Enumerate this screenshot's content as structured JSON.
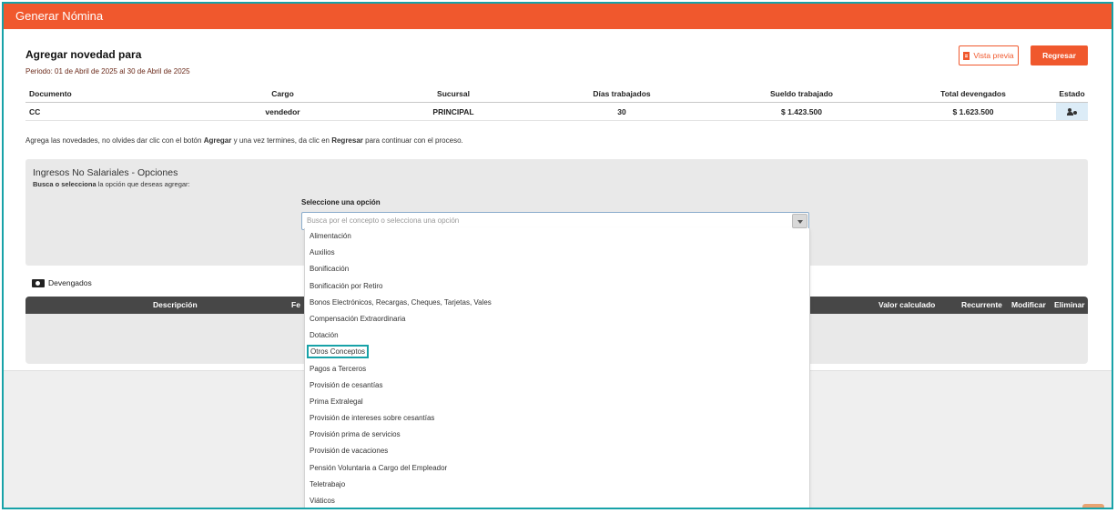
{
  "header": {
    "title": "Generar Nómina"
  },
  "page": {
    "title": "Agregar novedad para",
    "period": "Periodo: 01 de Abril de 2025 al 30 de Abril de 2025",
    "preview_label": "Vista previa",
    "back_label": "Regresar"
  },
  "summary": {
    "columns": [
      "Documento",
      "Cargo",
      "Sucursal",
      "Días trabajados",
      "Sueldo trabajado",
      "Total devengados",
      "Estado"
    ],
    "row": {
      "documento": "CC",
      "cargo": "vendedor",
      "sucursal": "PRINCIPAL",
      "dias": "30",
      "sueldo": "$ 1.423.500",
      "total": "$ 1.623.500"
    }
  },
  "note": {
    "part1": "Agrega las novedades, no olvides dar clic con el botón ",
    "bold1": "Agregar",
    "part2": " y una vez termines, da clic en ",
    "bold2": "Regresar",
    "part3": " para continuar con el proceso."
  },
  "panel": {
    "title": "Ingresos No Salariales - Opciones",
    "sub_bold": "Busca o selecciona",
    "sub_rest": " la opción que deseas agregar:",
    "select_label": "Seleccione una opción",
    "select_placeholder": "Busca por el concepto o selecciona una opción"
  },
  "options": [
    "Alimentación",
    "Auxilios",
    "Bonificación",
    "Bonificación por Retiro",
    "Bonos Electrónicos, Recargas, Cheques, Tarjetas, Vales",
    "Compensación Extraordinaria",
    "Dotación",
    "Otros Conceptos",
    "Pagos a Terceros",
    "Provisión de cesantías",
    "Prima Extralegal",
    "Provisión de intereses sobre cesantías",
    "Provisión prima de servicios",
    "Provisión de vacaciones",
    "Pensión Voluntaria a Cargo del Empleador",
    "Teletrabajo",
    "Viáticos"
  ],
  "highlighted_option": "Otros Conceptos",
  "devengados": {
    "label": "Devengados",
    "columns": {
      "descripcion": "Descripción",
      "fecha": "Fe",
      "valor": "Valor calculado",
      "recurrente": "Recurrente",
      "modificar": "Modificar",
      "eliminar": "Eliminar"
    }
  },
  "colors": {
    "accent": "#f0582d",
    "highlight": "#17a2a8",
    "table_head": "#474747"
  }
}
